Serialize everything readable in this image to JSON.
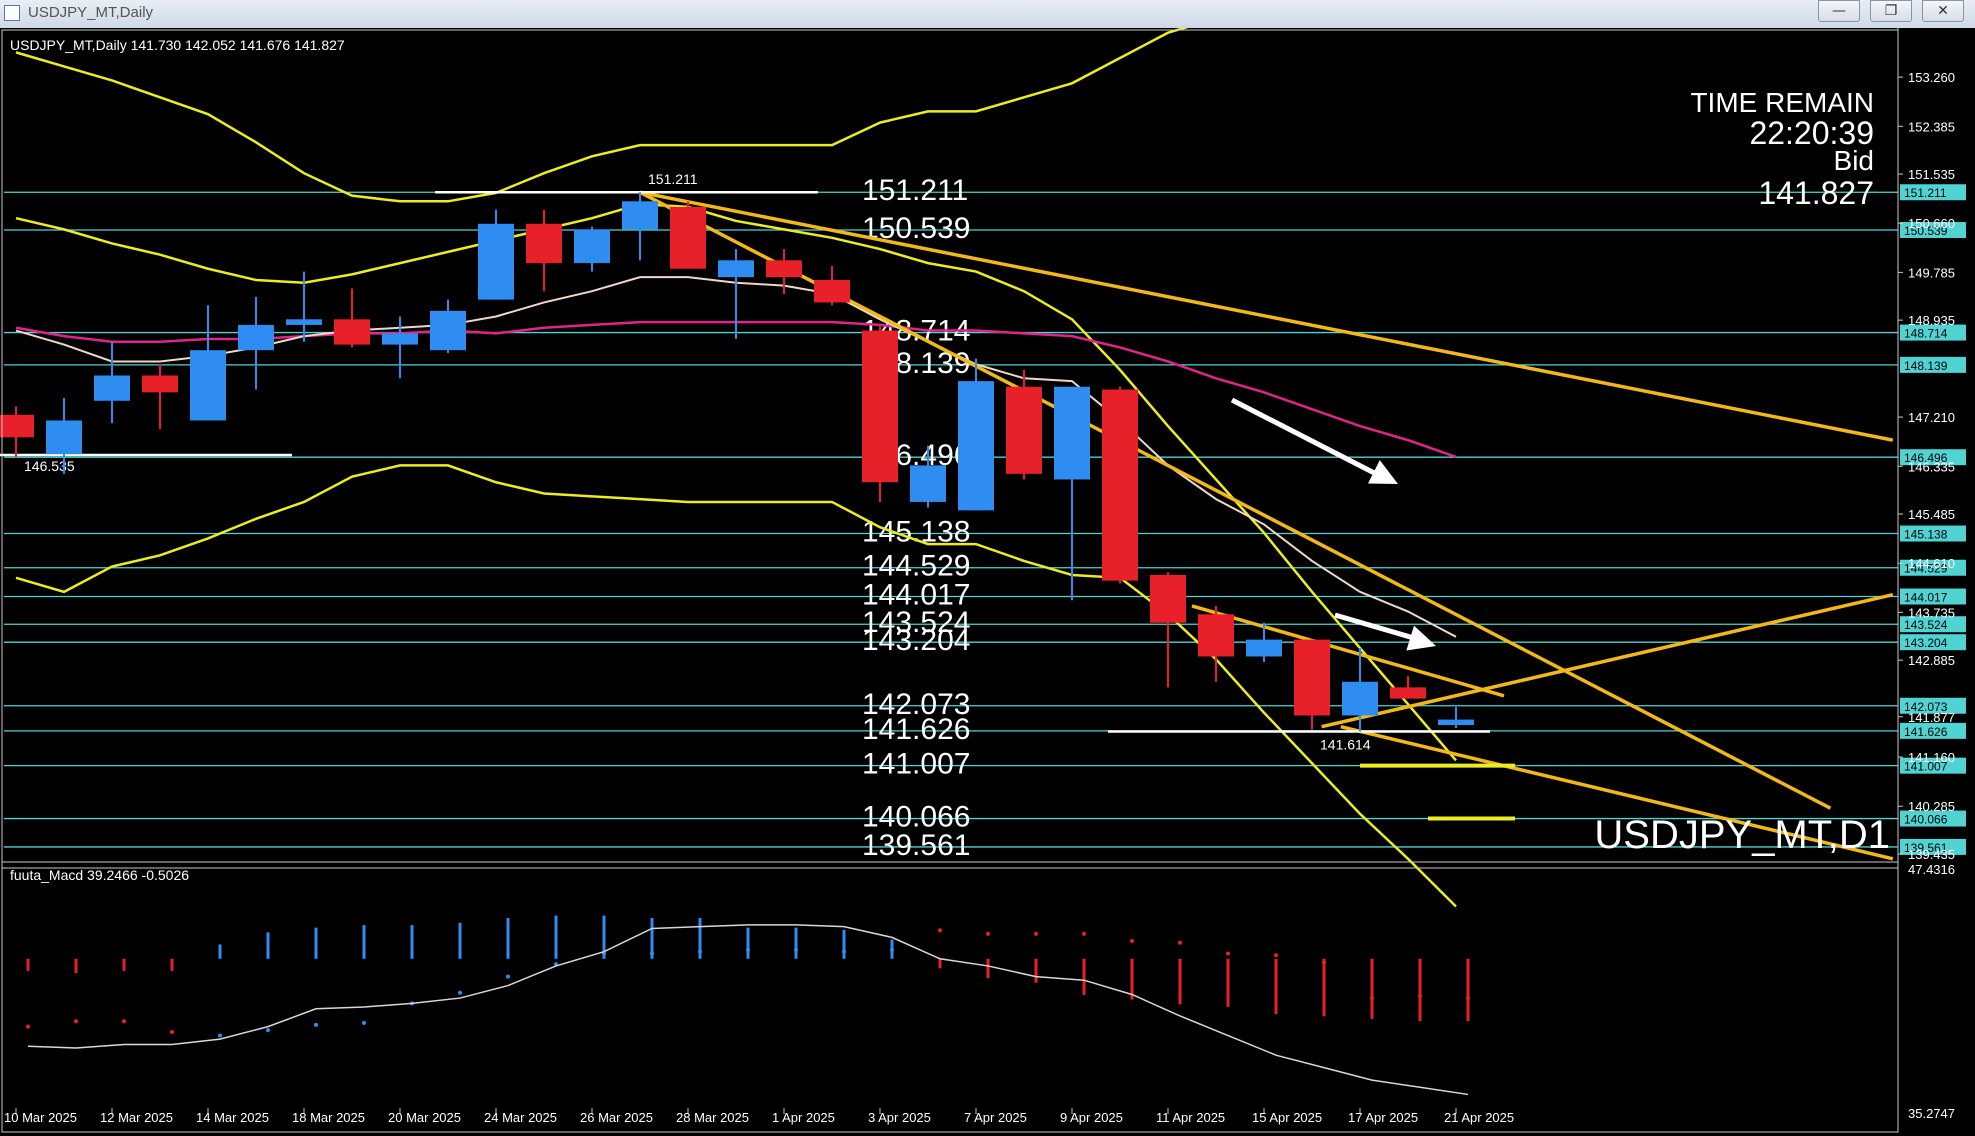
{
  "window": {
    "title": "USDJPY_MT,Daily",
    "buttons": {
      "minimize": "—",
      "restore": "❐",
      "close": "✕"
    }
  },
  "header": {
    "symbol_info": "USDJPY_MT,Daily  141.730 142.052 141.676 141.827"
  },
  "time_remain": {
    "label": "TIME REMAIN",
    "value": "22:20:39",
    "bid_label": "Bid",
    "bid": "141.827"
  },
  "watermark": "USDJPY_MT,D1",
  "indicator_label": "fuuta_Macd 39.2466  -0.5026",
  "price_axis": [
    "153.260",
    "152.385",
    "151.535",
    "150.660",
    "149.785",
    "148.935",
    "147.210",
    "146.335",
    "145.485",
    "144.610",
    "143.735",
    "142.885",
    "141.877",
    "141.160",
    "140.285",
    "139.435"
  ],
  "price_axis_y": [
    153.26,
    152.385,
    151.535,
    150.66,
    149.785,
    148.935,
    147.21,
    146.335,
    145.485,
    144.61,
    143.735,
    142.885,
    141.877,
    141.16,
    140.285,
    139.435
  ],
  "macd_axis": [
    "47.4316",
    "35.2747"
  ],
  "date_axis": [
    "10 Mar 2025",
    "12 Mar 2025",
    "14 Mar 2025",
    "18 Mar 2025",
    "20 Mar 2025",
    "24 Mar 2025",
    "26 Mar 2025",
    "28 Mar 2025",
    "1 Apr 2025",
    "3 Apr 2025",
    "7 Apr 2025",
    "9 Apr 2025",
    "11 Apr 2025",
    "15 Apr 2025",
    "17 Apr 2025",
    "21 Apr 2025"
  ],
  "levels": [
    {
      "value": 151.211,
      "label": "151.211"
    },
    {
      "value": 150.539,
      "label": "150.539"
    },
    {
      "value": 148.714,
      "label": "148.714"
    },
    {
      "value": 148.139,
      "label": "148.139"
    },
    {
      "value": 146.496,
      "label": "146.496"
    },
    {
      "value": 145.138,
      "label": "145.138"
    },
    {
      "value": 144.529,
      "label": "144.529"
    },
    {
      "value": 144.017,
      "label": "144.017"
    },
    {
      "value": 143.524,
      "label": "143.524"
    },
    {
      "value": 143.204,
      "label": "143.204"
    },
    {
      "value": 142.073,
      "label": "142.073"
    },
    {
      "value": 141.626,
      "label": "141.626"
    },
    {
      "value": 141.007,
      "label": "141.007"
    },
    {
      "value": 140.066,
      "label": "140.066"
    },
    {
      "value": 139.561,
      "label": "139.561"
    }
  ],
  "annotations": {
    "high_label": "151.211",
    "left_low_label": "146.535",
    "recent_low_label": "141.614"
  },
  "colors": {
    "background": "#000000",
    "bull": "#2f8cf0",
    "bear": "#e8202a",
    "levels": "#4fd3d3",
    "trendline": "#f2b81a",
    "bands": "#ecec24",
    "ma_pink": "#e0248a",
    "ma_white": "#f0d8c8",
    "arrows": "#ffffff"
  },
  "chart_data": {
    "type": "candlestick",
    "candles": [
      {
        "open": 147.25,
        "high": 147.4,
        "low": 146.5,
        "close": 146.85
      },
      {
        "open": 146.55,
        "high": 147.55,
        "low": 146.2,
        "close": 147.15
      },
      {
        "open": 147.5,
        "high": 148.55,
        "low": 147.1,
        "close": 147.95
      },
      {
        "open": 147.95,
        "high": 148.15,
        "low": 147.0,
        "close": 147.65
      },
      {
        "open": 147.15,
        "high": 149.2,
        "low": 147.15,
        "close": 148.4
      },
      {
        "open": 148.4,
        "high": 149.35,
        "low": 147.7,
        "close": 148.85
      },
      {
        "open": 148.85,
        "high": 149.8,
        "low": 148.55,
        "close": 148.95
      },
      {
        "open": 148.95,
        "high": 149.5,
        "low": 148.45,
        "close": 148.5
      },
      {
        "open": 148.5,
        "high": 149.0,
        "low": 147.9,
        "close": 148.7
      },
      {
        "open": 148.4,
        "high": 149.3,
        "low": 148.35,
        "close": 149.1
      },
      {
        "open": 149.3,
        "high": 150.9,
        "low": 149.3,
        "close": 150.65
      },
      {
        "open": 150.65,
        "high": 150.9,
        "low": 149.45,
        "close": 149.95
      },
      {
        "open": 149.95,
        "high": 150.6,
        "low": 149.8,
        "close": 150.55
      },
      {
        "open": 150.55,
        "high": 151.21,
        "low": 150.0,
        "close": 151.05
      },
      {
        "open": 150.95,
        "high": 151.05,
        "low": 149.85,
        "close": 149.85
      },
      {
        "open": 149.7,
        "high": 150.2,
        "low": 148.6,
        "close": 150.0
      },
      {
        "open": 150.0,
        "high": 150.2,
        "low": 149.4,
        "close": 149.7
      },
      {
        "open": 149.65,
        "high": 149.9,
        "low": 149.2,
        "close": 149.25
      },
      {
        "open": 148.75,
        "high": 148.85,
        "low": 145.7,
        "close": 146.05
      },
      {
        "open": 145.7,
        "high": 146.7,
        "low": 145.6,
        "close": 146.35
      },
      {
        "open": 145.55,
        "high": 148.25,
        "low": 145.55,
        "close": 147.85
      },
      {
        "open": 147.75,
        "high": 148.05,
        "low": 146.1,
        "close": 146.2
      },
      {
        "open": 146.1,
        "high": 147.75,
        "low": 143.95,
        "close": 147.75
      },
      {
        "open": 147.7,
        "high": 147.75,
        "low": 144.25,
        "close": 144.3
      },
      {
        "open": 144.4,
        "high": 144.45,
        "low": 142.4,
        "close": 143.55
      },
      {
        "open": 143.7,
        "high": 143.85,
        "low": 142.5,
        "close": 142.95
      },
      {
        "open": 142.95,
        "high": 143.55,
        "low": 142.85,
        "close": 143.25
      },
      {
        "open": 143.25,
        "high": 143.25,
        "low": 141.65,
        "close": 141.9
      },
      {
        "open": 141.9,
        "high": 143.1,
        "low": 141.614,
        "close": 142.5
      },
      {
        "open": 142.4,
        "high": 142.6,
        "low": 142.2,
        "close": 142.2
      },
      {
        "open": 141.73,
        "high": 142.052,
        "low": 141.676,
        "close": 141.827
      }
    ],
    "ma_pink": [
      148.8,
      148.65,
      148.55,
      148.55,
      148.6,
      148.6,
      148.65,
      148.7,
      148.7,
      148.75,
      148.7,
      148.8,
      148.85,
      148.9,
      148.9,
      148.9,
      148.9,
      148.9,
      148.85,
      148.75,
      148.75,
      148.7,
      148.65,
      148.45,
      148.2,
      147.9,
      147.65,
      147.35,
      147.05,
      146.8,
      146.5
    ],
    "ma_white": [
      148.75,
      148.5,
      148.2,
      148.2,
      148.3,
      148.45,
      148.65,
      148.75,
      148.8,
      148.85,
      149.0,
      149.25,
      149.45,
      149.7,
      149.7,
      149.6,
      149.55,
      149.4,
      148.95,
      148.55,
      148.15,
      147.9,
      147.85,
      147.15,
      146.35,
      145.75,
      145.3,
      144.65,
      144.1,
      143.75,
      143.3
    ],
    "bb_upper": [
      153.7,
      153.45,
      153.2,
      152.9,
      152.6,
      152.1,
      151.55,
      151.15,
      151.05,
      151.05,
      151.2,
      151.55,
      151.85,
      152.05,
      152.05,
      152.05,
      152.05,
      152.05,
      152.45,
      152.65,
      152.65,
      152.9,
      153.15,
      153.6,
      154.05,
      154.3,
      154.55,
      154.65,
      154.65,
      154.6,
      154.35
    ],
    "bb_mid": [
      150.75,
      150.55,
      150.3,
      150.1,
      149.85,
      149.65,
      149.6,
      149.75,
      149.95,
      150.15,
      150.35,
      150.55,
      150.75,
      151.0,
      150.95,
      150.7,
      150.55,
      150.4,
      150.2,
      149.95,
      149.8,
      149.45,
      148.95,
      148.05,
      147.05,
      146.1,
      145.15,
      144.1,
      143.1,
      142.1,
      141.1
    ],
    "bb_lower": [
      144.35,
      144.1,
      144.55,
      144.75,
      145.05,
      145.4,
      145.7,
      146.15,
      146.35,
      146.35,
      146.05,
      145.85,
      145.8,
      145.75,
      145.7,
      145.7,
      145.7,
      145.7,
      145.25,
      144.95,
      144.95,
      144.65,
      144.4,
      144.35,
      143.7,
      142.9,
      141.95,
      141.05,
      140.15,
      139.35,
      138.5
    ],
    "macd_histogram": [
      -0.5,
      -0.6,
      -0.5,
      -0.5,
      0.6,
      1.1,
      1.3,
      1.4,
      1.4,
      1.5,
      1.7,
      1.8,
      1.8,
      1.7,
      1.7,
      1.3,
      1.3,
      1.2,
      0.8,
      -0.4,
      -0.8,
      -1.0,
      -1.5,
      -1.7,
      -1.9,
      -2.0,
      -2.3,
      -2.4,
      -2.5,
      -2.6,
      -2.6
    ],
    "macd_line": [
      37.9,
      37.8,
      38.0,
      38.0,
      38.3,
      39.0,
      40.0,
      40.1,
      40.3,
      40.6,
      41.3,
      42.4,
      43.2,
      44.5,
      44.6,
      44.7,
      44.7,
      44.6,
      44.0,
      42.8,
      42.4,
      41.8,
      41.6,
      40.8,
      39.6,
      38.5,
      37.4,
      36.7,
      36.0,
      35.6,
      35.2
    ],
    "macd_signal_dots": [
      39.0,
      39.3,
      39.3,
      38.7,
      38.5,
      38.8,
      39.1,
      39.2,
      40.3,
      40.9,
      41.8,
      42.5,
      43.1,
      43.1,
      43.2,
      43.3,
      43.3,
      43.2,
      43.3,
      44.4,
      44.2,
      44.2,
      44.2,
      43.8,
      43.7,
      43.1,
      43.0,
      42.6,
      40.6,
      40.7,
      40.6
    ],
    "price_range": [
      139.435,
      153.6
    ],
    "macd_range": [
      35.0,
      48.0
    ]
  }
}
